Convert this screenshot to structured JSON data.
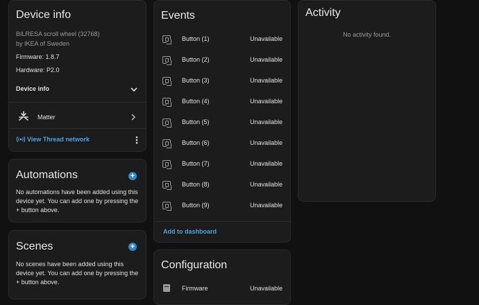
{
  "device_info": {
    "title": "Device info",
    "model": "BILRESA scroll wheel (32768)",
    "manufacturer": "by IKEA of Sweden",
    "firmware": "Firmware: 1.8.7",
    "hardware": "Hardware: P2.0",
    "expand_label": "Device info",
    "integration_label": "Matter",
    "thread_link": "View Thread network"
  },
  "automations": {
    "title": "Automations",
    "text": "No automations have been added using this device yet. You can add one by pressing the + button above."
  },
  "scenes": {
    "title": "Scenes",
    "text": "No scenes have been added using this device yet. You can add one by pressing the + button above."
  },
  "events": {
    "title": "Events",
    "items": [
      {
        "label": "Button (1)",
        "state": "Unavailable"
      },
      {
        "label": "Button (2)",
        "state": "Unavailable"
      },
      {
        "label": "Button (3)",
        "state": "Unavailable"
      },
      {
        "label": "Button (4)",
        "state": "Unavailable"
      },
      {
        "label": "Button (5)",
        "state": "Unavailable"
      },
      {
        "label": "Button (6)",
        "state": "Unavailable"
      },
      {
        "label": "Button (7)",
        "state": "Unavailable"
      },
      {
        "label": "Button (8)",
        "state": "Unavailable"
      },
      {
        "label": "Button (9)",
        "state": "Unavailable"
      }
    ],
    "add_to_dashboard": "Add to dashboard"
  },
  "configuration": {
    "title": "Configuration",
    "items": [
      {
        "label": "Firmware",
        "state": "Unavailable"
      }
    ]
  },
  "activity": {
    "title": "Activity",
    "empty": "No activity found."
  },
  "colors": {
    "background": "#111111",
    "card": "#1c1c1c",
    "accent": "#4fa3e0",
    "plus_button": "#2f86cc"
  },
  "icons": {
    "expand": "chevron-down-icon",
    "integration": "matter-icon",
    "integration_arrow": "chevron-right-icon",
    "thread": "thread-signal-icon",
    "more": "more-vertical-icon",
    "add": "plus-circle-icon",
    "event_item": "button-press-icon",
    "config_item": "firmware-icon"
  }
}
